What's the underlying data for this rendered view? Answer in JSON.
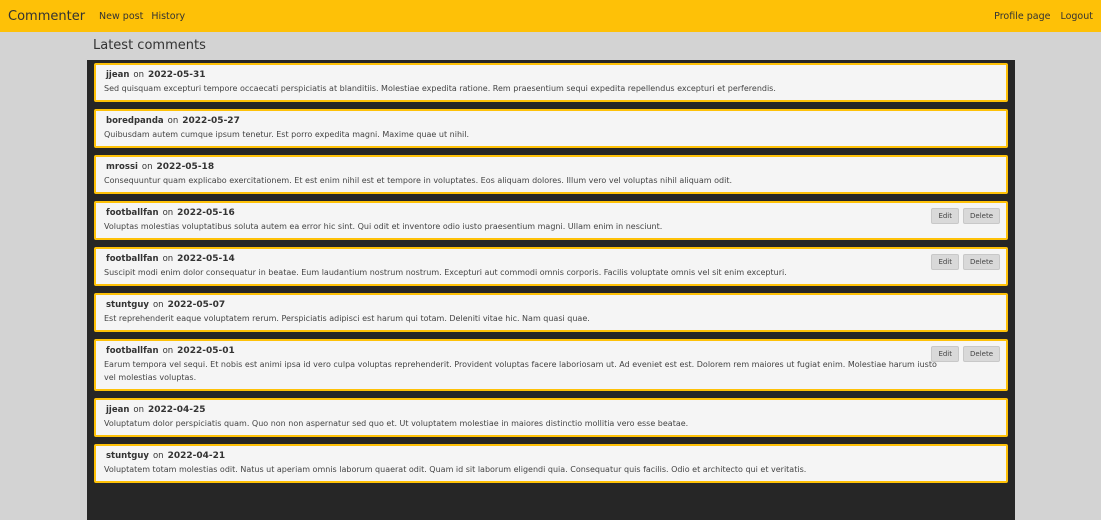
{
  "nav": {
    "brand": "Commenter",
    "new_post": "New post",
    "history": "History",
    "profile": "Profile page",
    "logout": "Logout"
  },
  "page": {
    "title": "Latest comments"
  },
  "labels": {
    "on": "on",
    "edit": "Edit",
    "delete": "Delete"
  },
  "comments": [
    {
      "author": "jjean",
      "date": "2022-05-31",
      "text": "Sed quisquam excepturi tempore occaecati perspiciatis at blanditiis. Molestiae expedita ratione. Rem praesentium sequi expedita repellendus excepturi et perferendis.",
      "editable": false
    },
    {
      "author": "boredpanda",
      "date": "2022-05-27",
      "text": "Quibusdam autem cumque ipsum tenetur. Est porro expedita magni. Maxime quae ut nihil.",
      "editable": false
    },
    {
      "author": "mrossi",
      "date": "2022-05-18",
      "text": "Consequuntur quam explicabo exercitationem. Et est enim nihil est et tempore in voluptates. Eos aliquam dolores. Illum vero vel voluptas nihil aliquam odit.",
      "editable": false
    },
    {
      "author": "footballfan",
      "date": "2022-05-16",
      "text": "Voluptas molestias voluptatibus soluta autem ea error hic sint. Qui odit et inventore odio iusto praesentium magni. Ullam enim in nesciunt.",
      "editable": true
    },
    {
      "author": "footballfan",
      "date": "2022-05-14",
      "text": "Suscipit modi enim dolor consequatur in beatae. Eum laudantium nostrum nostrum. Excepturi aut commodi omnis corporis. Facilis voluptate omnis vel sit enim excepturi.",
      "editable": true
    },
    {
      "author": "stuntguy",
      "date": "2022-05-07",
      "text": "Est reprehenderit eaque voluptatem rerum. Perspiciatis adipisci est harum qui totam. Deleniti vitae hic. Nam quasi quae.",
      "editable": false
    },
    {
      "author": "footballfan",
      "date": "2022-05-01",
      "text": "Earum tempora vel sequi. Et nobis est animi ipsa id vero culpa voluptas reprehenderit. Provident voluptas facere laboriosam ut. Ad eveniet est est. Dolorem rem maiores ut fugiat enim. Molestiae harum iusto vel molestias voluptas.",
      "editable": true
    },
    {
      "author": "jjean",
      "date": "2022-04-25",
      "text": "Voluptatum dolor perspiciatis quam. Quo non non aspernatur sed quo et. Ut voluptatem molestiae in maiores distinctio mollitia vero esse beatae.",
      "editable": false
    },
    {
      "author": "stuntguy",
      "date": "2022-04-21",
      "text": "Voluptatem totam molestias odit. Natus ut aperiam omnis laborum quaerat odit. Quam id sit laborum eligendi quia. Consequatur quis facilis. Odio et architecto qui et veritatis.",
      "editable": false
    }
  ]
}
